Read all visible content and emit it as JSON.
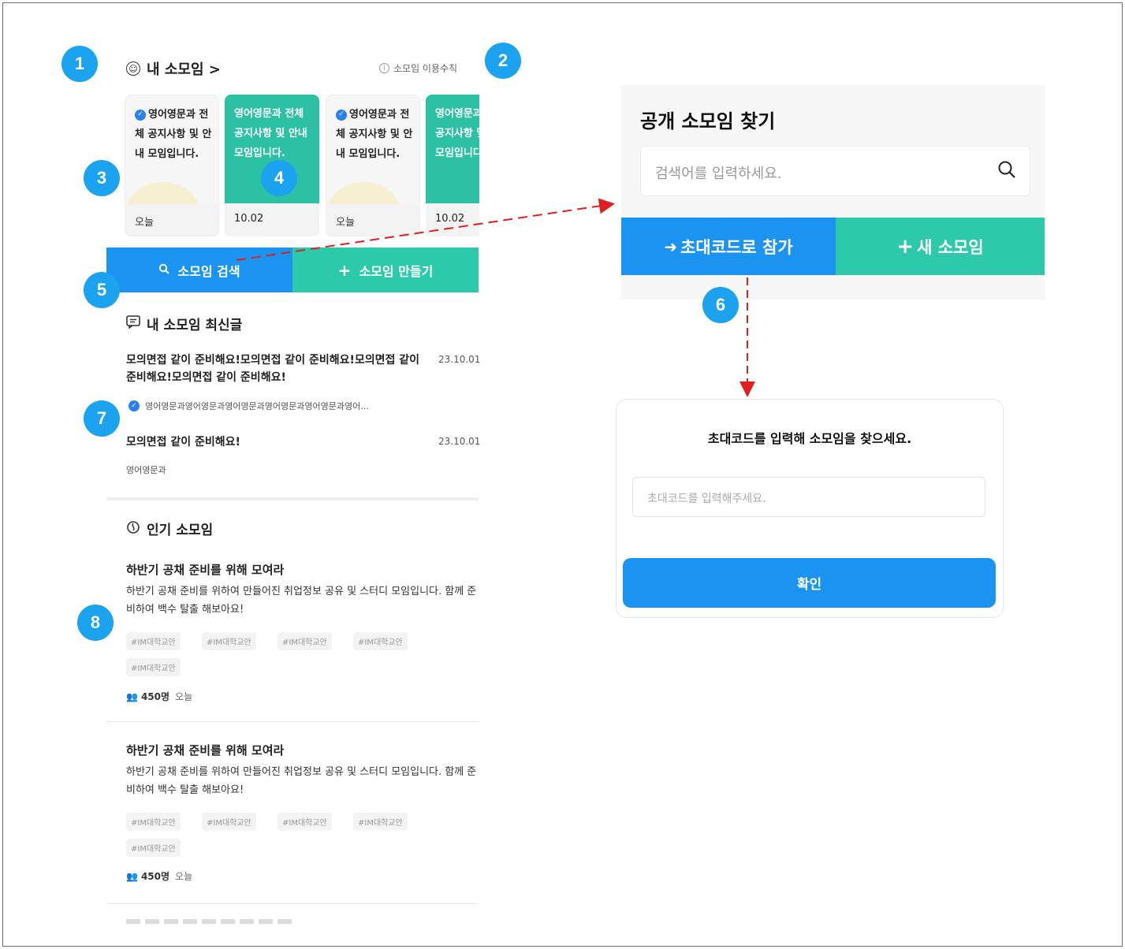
{
  "badges": [
    "1",
    "2",
    "3",
    "4",
    "5",
    "6",
    "7",
    "8"
  ],
  "my_group": {
    "title": "내 소모임 >",
    "notice": "소모임 이용수칙",
    "cards": [
      {
        "text": "영어영문과 전체 공지사항 및 안내 모임입니다.",
        "date": "오늘",
        "style": "white",
        "verified": true
      },
      {
        "text": "영어영문과 전체 공지사항 및 안내 모임입니다.",
        "date": "10.02",
        "style": "green",
        "verified": false
      },
      {
        "text": "영어영문과 전체 공지사항 및 안내 모임입니다.",
        "date": "오늘",
        "style": "white",
        "verified": true
      },
      {
        "text": "영어영문과 전체 공지사항 및 안내 모임입니다.",
        "date": "10.02",
        "style": "green",
        "verified": false
      }
    ]
  },
  "actions": {
    "search_label": "소모임 검색",
    "create_label": "소모임 만들기"
  },
  "latest": {
    "title": "내 소모임 최신글",
    "posts": [
      {
        "title": "모의면접 같이 준비해요!모의면접 같이 준비해요!모의면접 같이 준비해요!모의면접 같이 준비해요!",
        "date": "23.10.01",
        "group": "영어영문과영어영문과영어영문과영어영문과영어영문과영어..."
      },
      {
        "title": "모의면접 같이 준비해요!",
        "date": "23.10.01",
        "group": "영어영문과"
      }
    ]
  },
  "popular": {
    "title": "인기 소모임",
    "items": [
      {
        "title": "하반기 공채 준비를 위해 모여라",
        "desc": "하반기 공채 준비를 위하여 만들어진 취업정보 공유 및 스터디 모임입니다. 함께 준비하여 백수 탈출 해보아요!",
        "tags": [
          "#IM대학교안",
          "#IM대학교안",
          "#IM대학교안",
          "#IM대학교안",
          "#IM대학교안"
        ],
        "members": "450명",
        "when": "오늘"
      },
      {
        "title": "하반기 공채 준비를 위해 모여라",
        "desc": "하반기 공채 준비를 위하여 만들어진 취업정보 공유 및 스터디 모임입니다. 함께 준비하여 백수 탈출 해보아요!",
        "tags": [
          "#IM대학교안",
          "#IM대학교안",
          "#IM대학교안",
          "#IM대학교안",
          "#IM대학교안"
        ],
        "members": "450명",
        "when": "오늘"
      }
    ]
  },
  "public_search": {
    "title": "공개 소모임 찾기",
    "placeholder": "검색어를 입력하세요.",
    "join_label": "초대코드로 참가",
    "new_label": "새 소모임"
  },
  "invite": {
    "heading": "초대코드를 입력해 소모임을 찾으세요.",
    "placeholder": "초대코드를 입력해주세요.",
    "confirm_label": "확인"
  },
  "colors": {
    "blue": "#1b93f0",
    "green": "#2cc9aa",
    "badge": "#1ba3ef",
    "arrow": "#e02020"
  }
}
